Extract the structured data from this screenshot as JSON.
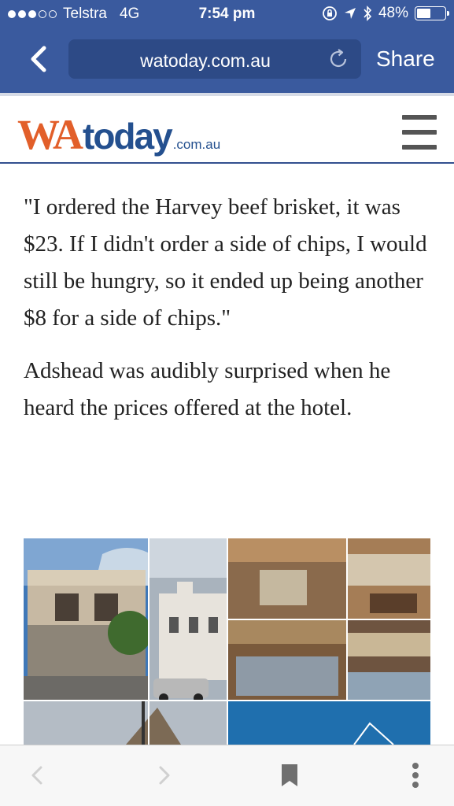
{
  "status_bar": {
    "carrier": "Telstra",
    "network": "4G",
    "time": "7:54 pm",
    "battery": "48%",
    "battery_level": 0.48
  },
  "browser": {
    "url": "watoday.com.au",
    "share_label": "Share"
  },
  "site": {
    "logo_wa": "WA",
    "logo_today": "today",
    "logo_domain": ".com.au"
  },
  "article": {
    "paragraphs": [
      "\"I ordered the Harvey beef brisket, it was $23. If I didn't order a side of chips, I would still be hungry, so it ended up being another $8 for a side of chips.\"",
      "Adshead was audibly surprised when he heard the prices offered at the hotel."
    ]
  },
  "icons": {
    "back": "chevron-left-icon",
    "reload": "reload-icon",
    "menu": "hamburger-menu-icon",
    "nav_back": "arrow-left-icon",
    "nav_forward": "arrow-right-icon",
    "bookmark": "bookmark-icon",
    "more": "more-vertical-icon"
  },
  "colors": {
    "chrome_blue": "#3a5a9e",
    "logo_orange": "#e25f2a",
    "logo_blue": "#24508f"
  }
}
